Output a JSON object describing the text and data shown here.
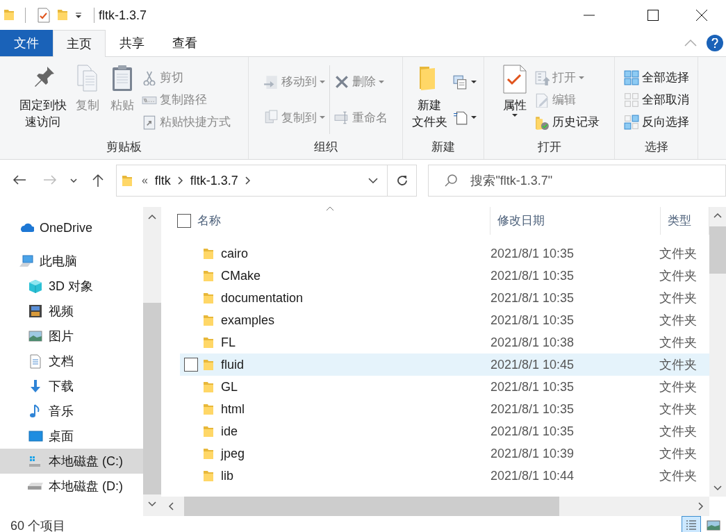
{
  "title_bar": {
    "title": "fltk-1.3.7"
  },
  "ribbon_tabs": [
    {
      "label": "文件",
      "kind": "file",
      "selected": false
    },
    {
      "label": "主页",
      "kind": "tab",
      "selected": true
    },
    {
      "label": "共享",
      "kind": "tab",
      "selected": false
    },
    {
      "label": "查看",
      "kind": "tab",
      "selected": false
    }
  ],
  "ribbon_groups": [
    {
      "label": "剪贴板",
      "columns": [
        [
          {
            "kind": "large",
            "lines": [
              "固定到快",
              "速访问"
            ],
            "disabled": false,
            "dropdown": false
          }
        ],
        [
          {
            "kind": "large",
            "lines": [
              "复制"
            ],
            "disabled": true,
            "dropdown": false
          }
        ],
        [
          {
            "kind": "large",
            "lines": [
              "粘贴"
            ],
            "disabled": true,
            "dropdown": false
          }
        ],
        [
          {
            "kind": "small",
            "label": "剪切",
            "disabled": true,
            "dropdown": false
          },
          {
            "kind": "small",
            "label": "复制路径",
            "disabled": true,
            "dropdown": false
          },
          {
            "kind": "small",
            "label": "粘贴快捷方式",
            "disabled": true,
            "dropdown": false
          }
        ]
      ]
    },
    {
      "label": "组织",
      "columns": [
        [
          {
            "kind": "small",
            "label": "移动到",
            "disabled": true,
            "dropdown": true
          },
          {
            "kind": "small",
            "label": "复制到",
            "disabled": true,
            "dropdown": true
          }
        ],
        [
          {
            "kind": "small",
            "label": "删除",
            "disabled": true,
            "dropdown": true
          },
          {
            "kind": "small",
            "label": "重命名",
            "disabled": true,
            "dropdown": false
          }
        ]
      ]
    },
    {
      "label": "新建",
      "columns": [
        [
          {
            "kind": "large",
            "lines": [
              "新建",
              "文件夹"
            ],
            "disabled": false,
            "dropdown": false
          }
        ],
        [
          {
            "kind": "icon",
            "disabled": false,
            "dropdown": true
          },
          {
            "kind": "icon",
            "disabled": false,
            "dropdown": true
          }
        ]
      ]
    },
    {
      "label": "打开",
      "columns": [
        [
          {
            "kind": "large",
            "lines": [
              "属性"
            ],
            "disabled": false,
            "dropdown": true
          }
        ],
        [
          {
            "kind": "small",
            "label": "打开",
            "disabled": true,
            "dropdown": true
          },
          {
            "kind": "small",
            "label": "编辑",
            "disabled": true,
            "dropdown": false
          },
          {
            "kind": "small",
            "label": "历史记录",
            "disabled": false,
            "dropdown": false
          }
        ]
      ]
    },
    {
      "label": "选择",
      "columns": [
        [
          {
            "kind": "small",
            "label": "全部选择",
            "disabled": false,
            "dropdown": false
          },
          {
            "kind": "small",
            "label": "全部取消",
            "disabled": false,
            "dropdown": false
          },
          {
            "kind": "small",
            "label": "反向选择",
            "disabled": false,
            "dropdown": false
          }
        ]
      ]
    }
  ],
  "nav_buttons": [
    {
      "kind": "back",
      "disabled": false
    },
    {
      "kind": "forward",
      "disabled": true
    },
    {
      "kind": "recent",
      "disabled": false
    },
    {
      "kind": "up",
      "disabled": false
    }
  ],
  "address_bar": {
    "overflow": "«",
    "crumbs": [
      "fltk",
      "fltk-1.3.7"
    ]
  },
  "search": {
    "placeholder": "搜索\"fltk-1.3.7\""
  },
  "sidebar": {
    "items": [
      {
        "label": "OneDrive",
        "selected": false
      },
      {
        "label": "此电脑",
        "selected": false,
        "children": [
          {
            "label": "3D 对象",
            "selected": false
          },
          {
            "label": "视频",
            "selected": false
          },
          {
            "label": "图片",
            "selected": false
          },
          {
            "label": "文档",
            "selected": false
          },
          {
            "label": "下载",
            "selected": false
          },
          {
            "label": "音乐",
            "selected": false
          },
          {
            "label": "桌面",
            "selected": false
          },
          {
            "label": "本地磁盘 (C:)",
            "selected": true
          },
          {
            "label": "本地磁盘 (D:)",
            "selected": false
          }
        ]
      }
    ]
  },
  "file_list": {
    "select_all_checked": false,
    "columns": [
      "名称",
      "修改日期",
      "类型"
    ],
    "rows": [
      {
        "name": "cairo",
        "date": "2021/8/1 10:35",
        "type": "文件夹",
        "hovered": false
      },
      {
        "name": "CMake",
        "date": "2021/8/1 10:35",
        "type": "文件夹",
        "hovered": false
      },
      {
        "name": "documentation",
        "date": "2021/8/1 10:35",
        "type": "文件夹",
        "hovered": false
      },
      {
        "name": "examples",
        "date": "2021/8/1 10:35",
        "type": "文件夹",
        "hovered": false
      },
      {
        "name": "FL",
        "date": "2021/8/1 10:38",
        "type": "文件夹",
        "hovered": false
      },
      {
        "name": "fluid",
        "date": "2021/8/1 10:45",
        "type": "文件夹",
        "hovered": true
      },
      {
        "name": "GL",
        "date": "2021/8/1 10:35",
        "type": "文件夹",
        "hovered": false
      },
      {
        "name": "html",
        "date": "2021/8/1 10:35",
        "type": "文件夹",
        "hovered": false
      },
      {
        "name": "ide",
        "date": "2021/8/1 10:35",
        "type": "文件夹",
        "hovered": false
      },
      {
        "name": "jpeg",
        "date": "2021/8/1 10:39",
        "type": "文件夹",
        "hovered": false
      },
      {
        "name": "lib",
        "date": "2021/8/1 10:44",
        "type": "文件夹",
        "hovered": false
      }
    ]
  },
  "status_bar": {
    "count": "60 个项目",
    "view_modes": [
      {
        "kind": "details",
        "selected": true
      },
      {
        "kind": "thumbnails",
        "selected": false
      }
    ]
  }
}
